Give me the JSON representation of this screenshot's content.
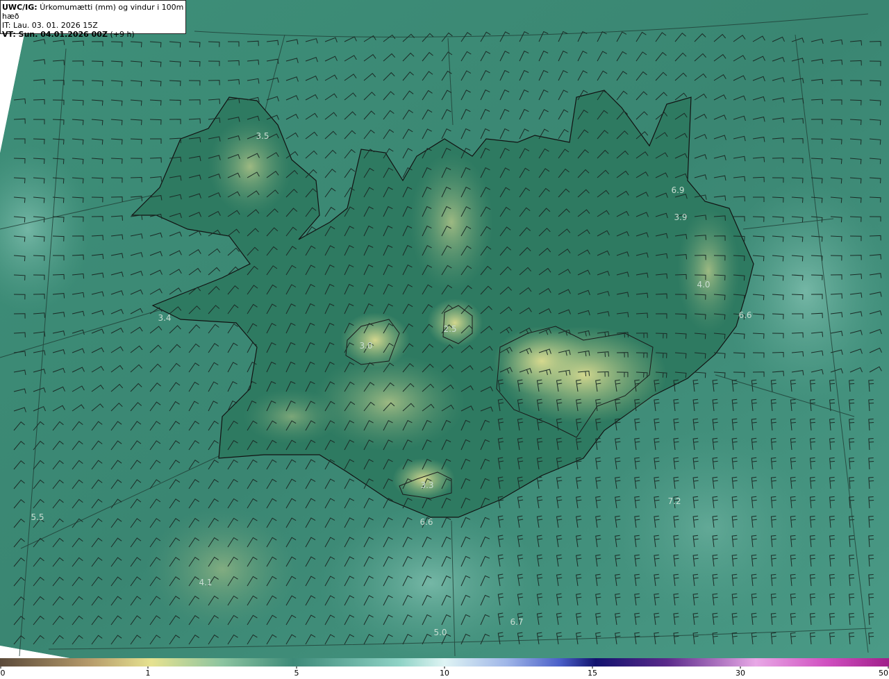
{
  "header": {
    "model_label": "UWC/IG:",
    "title": "Úrkomumætti (mm) og vindur i 100m hæð",
    "init_time": "IT: Lau. 03. 01. 2026 15Z",
    "valid_prefix": "VT: Sun. 04.01.2026 00Z",
    "valid_suffix": "(+9 h)"
  },
  "point_values": [
    "3.5",
    "6.9",
    "3.9",
    "4.0",
    "6.6",
    "3.4",
    "3.0",
    "2.5",
    "3.3",
    "6.6",
    "7.2",
    "5.5",
    "4.1",
    "5.0",
    "6.7"
  ],
  "colorbar": {
    "ticks": [
      "0",
      "1",
      "5",
      "10",
      "15",
      "30",
      "50"
    ],
    "tick_values": [
      0,
      1,
      5,
      10,
      15,
      30,
      50
    ],
    "colors": [
      "#5b4636",
      "#b89b6a",
      "#e8e38a",
      "#6fb79a",
      "#cfeeee",
      "#7a8fd6",
      "#1a1a7a",
      "#8a3c9c",
      "#f0a0e0",
      "#a0208a"
    ]
  },
  "colors": {
    "sea": "#3d8a78",
    "land_low": "#2f7a62",
    "land_high": "#d8d88a",
    "coast": "#111111"
  }
}
